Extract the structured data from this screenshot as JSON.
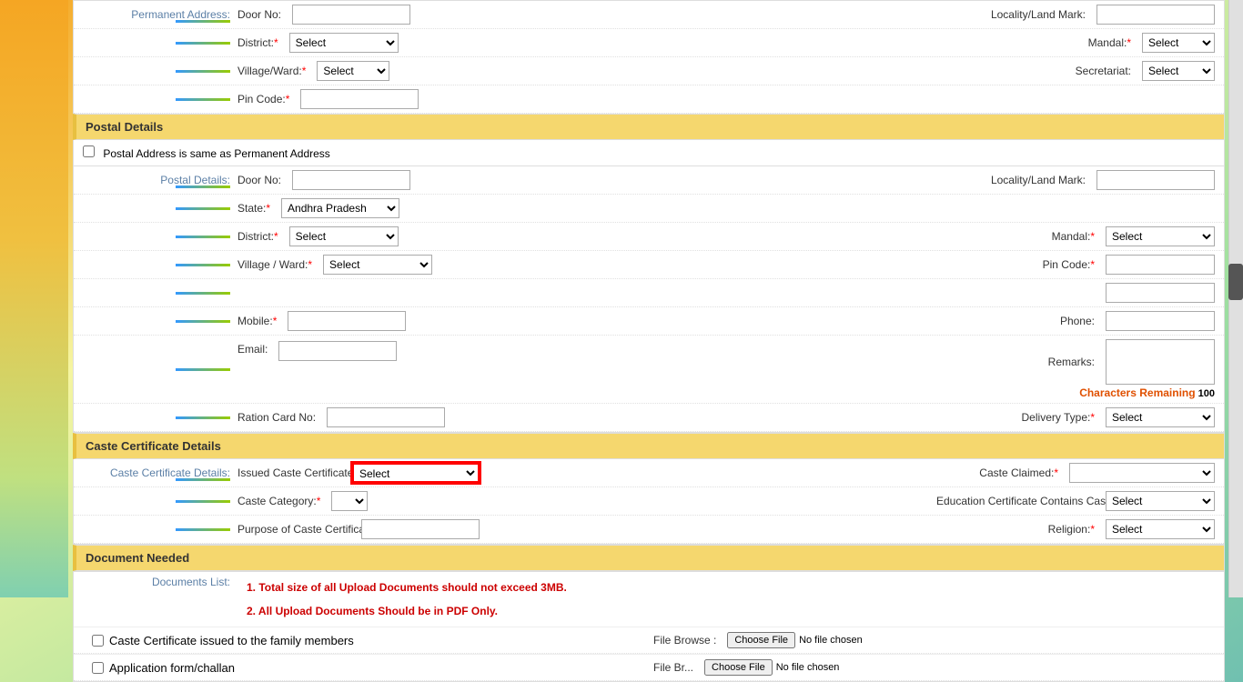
{
  "sections": {
    "permanentAddress": {
      "label": "Permanent Address:",
      "fields": {
        "doorNo": "Door No:",
        "locality": "Locality/Land Mark:",
        "district": "District:",
        "mandal": "Mandal:",
        "villageWard": "Village/Ward:",
        "secretariat": "Secretariat:",
        "pinCode": "Pin Code:"
      }
    },
    "postalDetails": {
      "sectionTitle": "Postal Details",
      "checkboxLabel": "Postal Address is same as Permanent Address",
      "label": "Postal Details:",
      "fields": {
        "doorNo": "Door No:",
        "locality": "Locality/Land Mark:",
        "state": "State:",
        "stateDefault": "Andhra Pradesh",
        "district": "District:",
        "mandal": "Mandal:",
        "villageWard": "Village / Ward:",
        "pinCode": "Pin Code:",
        "mobile": "Mobile:",
        "phone": "Phone:",
        "email": "Email:",
        "remarks": "Remarks:",
        "charRemaining": "Characters Remaining",
        "charCount": "100",
        "rationCardNo": "Ration Card No:",
        "deliveryType": "Delivery Type:"
      }
    },
    "casteDetails": {
      "sectionTitle": "Caste Certificate Details",
      "label": "Caste Certificate Details:",
      "fields": {
        "issuedCaste": "Issued Caste Certificate In Past:",
        "casteClaimed": "Caste Claimed:",
        "casteCategory": "Caste Category:",
        "educationCert": "Education Certificate Contains Caste:",
        "purposeOfCaste": "Purpose of Caste Certificate:",
        "religion": "Religion:"
      }
    },
    "documentNeeded": {
      "sectionTitle": "Document Needed",
      "label": "Documents List:",
      "info1": "1. Total size of all Upload Documents should not exceed 3MB.",
      "info2": "2. All Upload Documents Should be in PDF Only.",
      "doc1": "Caste Certificate issued to the family members",
      "fileBrowse": "File Browse :",
      "doc2": "Application form/challan",
      "fileBrowse2": "File Br..."
    }
  },
  "dropdowns": {
    "selectDefault": "Select",
    "andhraPradesh": "Andhra Pradesh"
  },
  "buttons": {
    "chooseFile": "Choose File",
    "noFileChosen": "No file chosen"
  }
}
